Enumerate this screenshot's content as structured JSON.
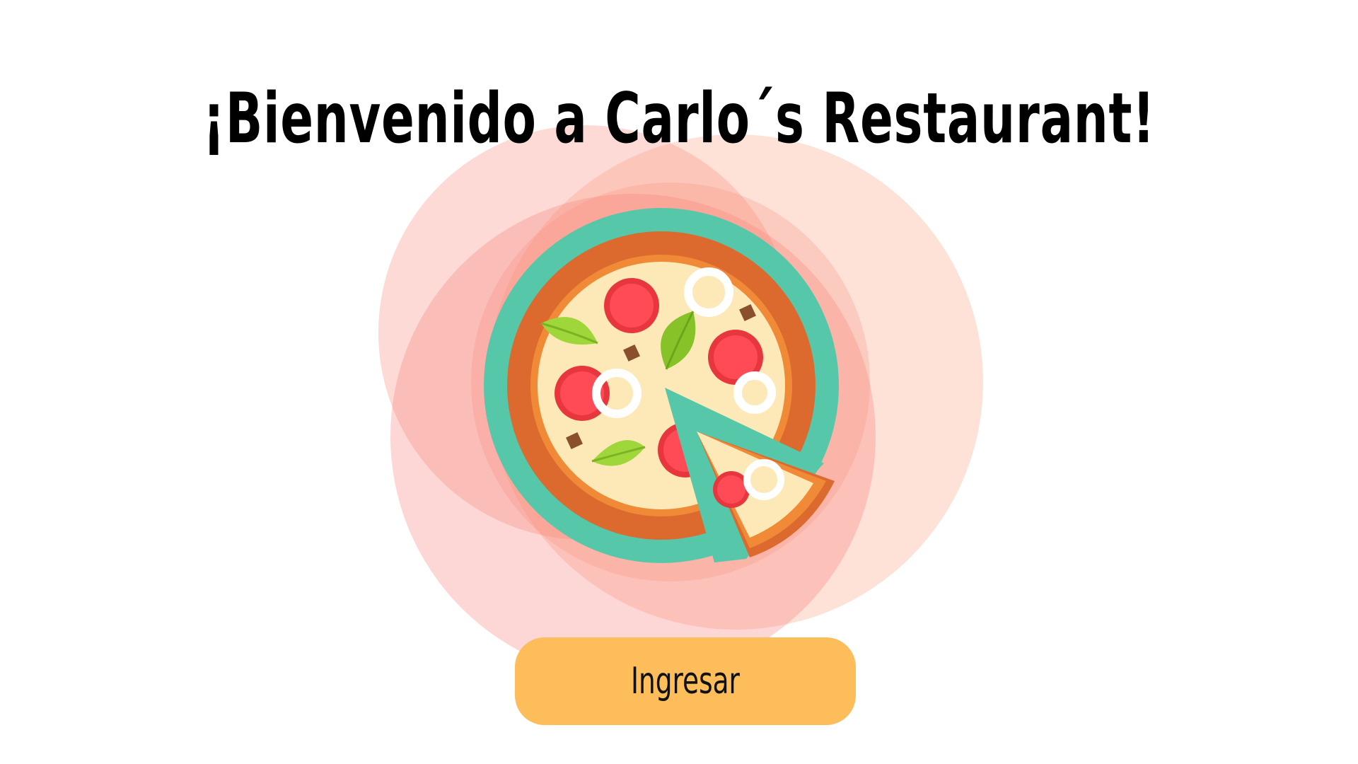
{
  "header": {
    "title": "¡Bienvenido a Carlo´s Restaurant!"
  },
  "hero": {
    "icon": "pizza-icon"
  },
  "actions": {
    "enter_label": "Ingresar"
  },
  "colors": {
    "button_bg": "#fdbd5a",
    "plate": "#57c7aa",
    "crust_dark": "#dc6a2e",
    "crust_light": "#f08a36",
    "cheese": "#fde9b7",
    "pepperoni": "#ff4b55",
    "basil": "#86c228",
    "background_glow": "#ff7b6b"
  }
}
